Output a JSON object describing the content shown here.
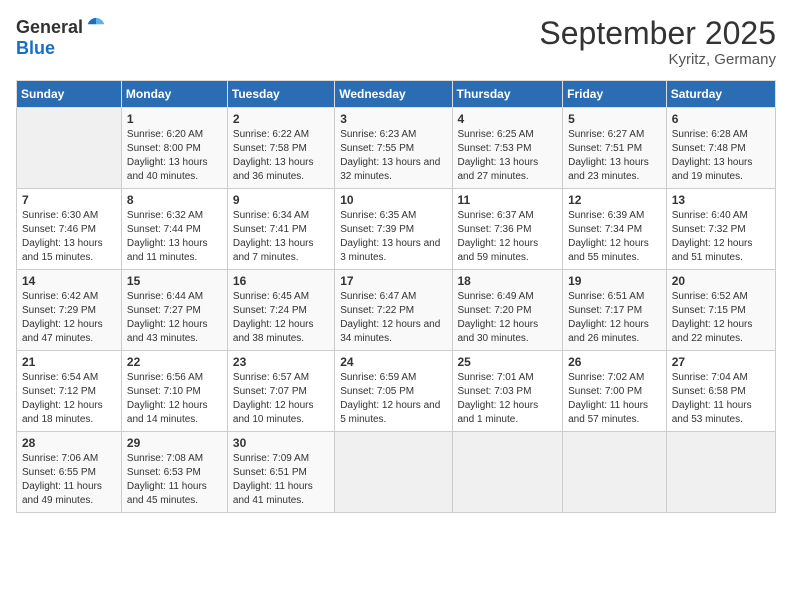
{
  "header": {
    "logo_general": "General",
    "logo_blue": "Blue",
    "month_title": "September 2025",
    "location": "Kyritz, Germany"
  },
  "days_of_week": [
    "Sunday",
    "Monday",
    "Tuesday",
    "Wednesday",
    "Thursday",
    "Friday",
    "Saturday"
  ],
  "weeks": [
    [
      {
        "day": "",
        "sunrise": "",
        "sunset": "",
        "daylight": "",
        "empty": true
      },
      {
        "day": "1",
        "sunrise": "Sunrise: 6:20 AM",
        "sunset": "Sunset: 8:00 PM",
        "daylight": "Daylight: 13 hours and 40 minutes."
      },
      {
        "day": "2",
        "sunrise": "Sunrise: 6:22 AM",
        "sunset": "Sunset: 7:58 PM",
        "daylight": "Daylight: 13 hours and 36 minutes."
      },
      {
        "day": "3",
        "sunrise": "Sunrise: 6:23 AM",
        "sunset": "Sunset: 7:55 PM",
        "daylight": "Daylight: 13 hours and 32 minutes."
      },
      {
        "day": "4",
        "sunrise": "Sunrise: 6:25 AM",
        "sunset": "Sunset: 7:53 PM",
        "daylight": "Daylight: 13 hours and 27 minutes."
      },
      {
        "day": "5",
        "sunrise": "Sunrise: 6:27 AM",
        "sunset": "Sunset: 7:51 PM",
        "daylight": "Daylight: 13 hours and 23 minutes."
      },
      {
        "day": "6",
        "sunrise": "Sunrise: 6:28 AM",
        "sunset": "Sunset: 7:48 PM",
        "daylight": "Daylight: 13 hours and 19 minutes."
      }
    ],
    [
      {
        "day": "7",
        "sunrise": "Sunrise: 6:30 AM",
        "sunset": "Sunset: 7:46 PM",
        "daylight": "Daylight: 13 hours and 15 minutes."
      },
      {
        "day": "8",
        "sunrise": "Sunrise: 6:32 AM",
        "sunset": "Sunset: 7:44 PM",
        "daylight": "Daylight: 13 hours and 11 minutes."
      },
      {
        "day": "9",
        "sunrise": "Sunrise: 6:34 AM",
        "sunset": "Sunset: 7:41 PM",
        "daylight": "Daylight: 13 hours and 7 minutes."
      },
      {
        "day": "10",
        "sunrise": "Sunrise: 6:35 AM",
        "sunset": "Sunset: 7:39 PM",
        "daylight": "Daylight: 13 hours and 3 minutes."
      },
      {
        "day": "11",
        "sunrise": "Sunrise: 6:37 AM",
        "sunset": "Sunset: 7:36 PM",
        "daylight": "Daylight: 12 hours and 59 minutes."
      },
      {
        "day": "12",
        "sunrise": "Sunrise: 6:39 AM",
        "sunset": "Sunset: 7:34 PM",
        "daylight": "Daylight: 12 hours and 55 minutes."
      },
      {
        "day": "13",
        "sunrise": "Sunrise: 6:40 AM",
        "sunset": "Sunset: 7:32 PM",
        "daylight": "Daylight: 12 hours and 51 minutes."
      }
    ],
    [
      {
        "day": "14",
        "sunrise": "Sunrise: 6:42 AM",
        "sunset": "Sunset: 7:29 PM",
        "daylight": "Daylight: 12 hours and 47 minutes."
      },
      {
        "day": "15",
        "sunrise": "Sunrise: 6:44 AM",
        "sunset": "Sunset: 7:27 PM",
        "daylight": "Daylight: 12 hours and 43 minutes."
      },
      {
        "day": "16",
        "sunrise": "Sunrise: 6:45 AM",
        "sunset": "Sunset: 7:24 PM",
        "daylight": "Daylight: 12 hours and 38 minutes."
      },
      {
        "day": "17",
        "sunrise": "Sunrise: 6:47 AM",
        "sunset": "Sunset: 7:22 PM",
        "daylight": "Daylight: 12 hours and 34 minutes."
      },
      {
        "day": "18",
        "sunrise": "Sunrise: 6:49 AM",
        "sunset": "Sunset: 7:20 PM",
        "daylight": "Daylight: 12 hours and 30 minutes."
      },
      {
        "day": "19",
        "sunrise": "Sunrise: 6:51 AM",
        "sunset": "Sunset: 7:17 PM",
        "daylight": "Daylight: 12 hours and 26 minutes."
      },
      {
        "day": "20",
        "sunrise": "Sunrise: 6:52 AM",
        "sunset": "Sunset: 7:15 PM",
        "daylight": "Daylight: 12 hours and 22 minutes."
      }
    ],
    [
      {
        "day": "21",
        "sunrise": "Sunrise: 6:54 AM",
        "sunset": "Sunset: 7:12 PM",
        "daylight": "Daylight: 12 hours and 18 minutes."
      },
      {
        "day": "22",
        "sunrise": "Sunrise: 6:56 AM",
        "sunset": "Sunset: 7:10 PM",
        "daylight": "Daylight: 12 hours and 14 minutes."
      },
      {
        "day": "23",
        "sunrise": "Sunrise: 6:57 AM",
        "sunset": "Sunset: 7:07 PM",
        "daylight": "Daylight: 12 hours and 10 minutes."
      },
      {
        "day": "24",
        "sunrise": "Sunrise: 6:59 AM",
        "sunset": "Sunset: 7:05 PM",
        "daylight": "Daylight: 12 hours and 5 minutes."
      },
      {
        "day": "25",
        "sunrise": "Sunrise: 7:01 AM",
        "sunset": "Sunset: 7:03 PM",
        "daylight": "Daylight: 12 hours and 1 minute."
      },
      {
        "day": "26",
        "sunrise": "Sunrise: 7:02 AM",
        "sunset": "Sunset: 7:00 PM",
        "daylight": "Daylight: 11 hours and 57 minutes."
      },
      {
        "day": "27",
        "sunrise": "Sunrise: 7:04 AM",
        "sunset": "Sunset: 6:58 PM",
        "daylight": "Daylight: 11 hours and 53 minutes."
      }
    ],
    [
      {
        "day": "28",
        "sunrise": "Sunrise: 7:06 AM",
        "sunset": "Sunset: 6:55 PM",
        "daylight": "Daylight: 11 hours and 49 minutes."
      },
      {
        "day": "29",
        "sunrise": "Sunrise: 7:08 AM",
        "sunset": "Sunset: 6:53 PM",
        "daylight": "Daylight: 11 hours and 45 minutes."
      },
      {
        "day": "30",
        "sunrise": "Sunrise: 7:09 AM",
        "sunset": "Sunset: 6:51 PM",
        "daylight": "Daylight: 11 hours and 41 minutes."
      },
      {
        "day": "",
        "sunrise": "",
        "sunset": "",
        "daylight": "",
        "empty": true
      },
      {
        "day": "",
        "sunrise": "",
        "sunset": "",
        "daylight": "",
        "empty": true
      },
      {
        "day": "",
        "sunrise": "",
        "sunset": "",
        "daylight": "",
        "empty": true
      },
      {
        "day": "",
        "sunrise": "",
        "sunset": "",
        "daylight": "",
        "empty": true
      }
    ]
  ]
}
